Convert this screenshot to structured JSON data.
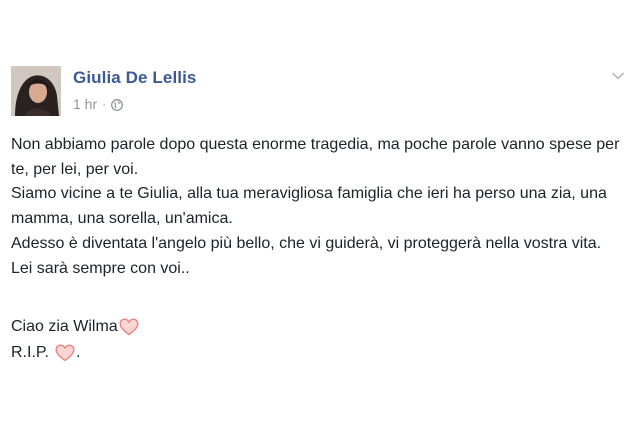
{
  "post": {
    "author": "Giulia De Lellis",
    "time": "1 hr",
    "dot": "·",
    "privacy_icon": "globe-icon",
    "menu_icon": "chevron-down-icon",
    "paragraphs": [
      "Non abbiamo parole dopo questa enorme tragedia, ma poche parole vanno spese per te, per lei, per voi.",
      "Siamo vicine a te Giulia, alla tua meravigliosa famiglia che ieri ha perso una zia, una mamma, una sorella, un'amica.",
      "Adesso è diventata l'angelo più bello, che vi guiderà, vi proteggerà nella vostra vita.",
      "Lei sarà sempre con voi.."
    ],
    "closing_line_1": "Ciao zia Wilma",
    "closing_line_2": "R.I.P.",
    "closing_line_2_end": ".",
    "heart_icon": "heart-icon",
    "colors": {
      "author": "#3b5998",
      "meta": "#90949c",
      "text": "#1d2129",
      "heart_stroke": "#e8847f",
      "heart_fill": "#f9d5d3"
    }
  }
}
